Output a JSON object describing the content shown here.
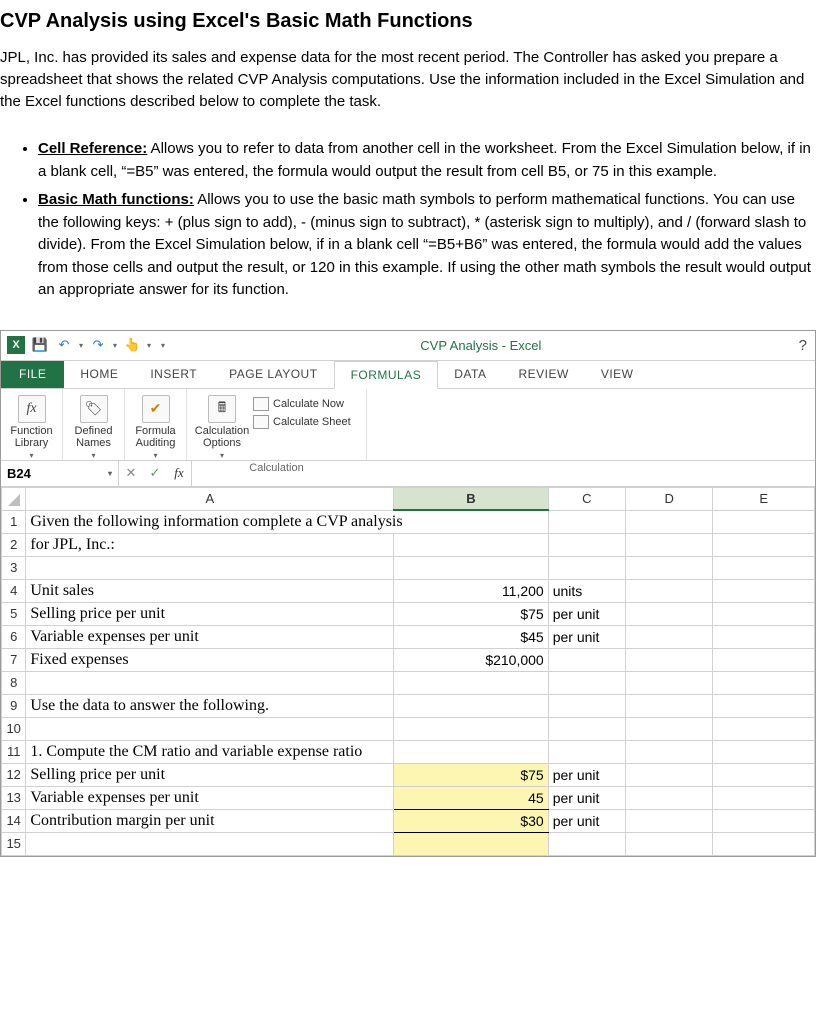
{
  "page": {
    "title": "CVP Analysis using Excel's Basic Math Functions",
    "intro": "JPL, Inc. has provided its sales and expense data for the most recent period.  The Controller has asked you prepare a spreadsheet that shows the related CVP Analysis computations.  Use the information included in the Excel Simulation and the Excel functions described below to complete the task.",
    "bullets": [
      {
        "title": "Cell Reference:",
        "body": "  Allows you to refer to data from another cell in the worksheet.  From the Excel Simulation below, if in a blank cell, “=B5” was entered, the formula would output the result from cell B5, or 75 in this example."
      },
      {
        "title": "Basic Math functions:",
        "body": "  Allows you to use the basic math symbols to perform mathematical functions.  You can use the following keys:  + (plus sign to add), - (minus sign to subtract), * (asterisk sign to multiply), and / (forward slash to divide).  From the Excel Simulation below, if in a blank cell “=B5+B6” was entered, the formula would add the values from those cells and output the result, or 120 in this example.  If using the other math symbols the result would output an appropriate answer for its function."
      }
    ]
  },
  "excel": {
    "window_title": "CVP Analysis - Excel",
    "help": "?",
    "tabs": {
      "file": "FILE",
      "home": "HOME",
      "insert": "INSERT",
      "pagelayout": "PAGE LAYOUT",
      "formulas": "FORMULAS",
      "data": "DATA",
      "review": "REVIEW",
      "view": "VIEW"
    },
    "ribbon": {
      "fx": "fx",
      "function_library": "Function Library",
      "defined_names": "Defined Names",
      "formula_auditing": "Formula Auditing",
      "calc_options": "Calculation Options",
      "calc_now": "Calculate Now",
      "calc_sheet": "Calculate Sheet",
      "group_calc": "Calculation"
    },
    "formula_bar": {
      "name_box": "B24",
      "cancel": "✕",
      "enter": "✓",
      "fx": "fx",
      "value": ""
    },
    "columns": {
      "a": "A",
      "b": "B",
      "c": "C",
      "d": "D",
      "e": "E"
    },
    "rows": {
      "r1": {
        "n": "1",
        "a": "Given the following information complete a CVP analysis"
      },
      "r2": {
        "n": "2",
        "a": "for JPL, Inc.:"
      },
      "r3": {
        "n": "3"
      },
      "r4": {
        "n": "4",
        "a": "Unit sales",
        "b": "11,200",
        "c": "units"
      },
      "r5": {
        "n": "5",
        "a": "Selling price per unit",
        "b": "$75",
        "c": "per unit"
      },
      "r6": {
        "n": "6",
        "a": "Variable expenses per unit",
        "b": "$45",
        "c": "per unit"
      },
      "r7": {
        "n": "7",
        "a": "Fixed expenses",
        "b": "$210,000"
      },
      "r8": {
        "n": "8"
      },
      "r9": {
        "n": "9",
        "a": "Use the data to answer the following."
      },
      "r10": {
        "n": "10"
      },
      "r11": {
        "n": "11",
        "a": "1. Compute the CM ratio and variable expense ratio"
      },
      "r12": {
        "n": "12",
        "a": "Selling price per unit",
        "b": "$75",
        "c": "per unit"
      },
      "r13": {
        "n": "13",
        "a": "Variable expenses per unit",
        "b": "45",
        "c": "per unit"
      },
      "r14": {
        "n": "14",
        "a": "Contribution margin per unit",
        "b": "$30",
        "c": "per unit"
      },
      "r15": {
        "n": "15"
      }
    }
  }
}
